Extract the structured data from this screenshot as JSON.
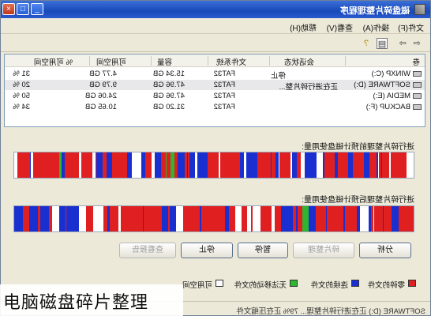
{
  "window": {
    "title": "磁盘碎片整理程序",
    "controls": [
      "_",
      "□",
      "×"
    ]
  },
  "menu": [
    "文件(F)",
    "操作(A)",
    "查看(V)",
    "帮助(H)"
  ],
  "toolbar": {
    "icons": [
      "back-icon",
      "forward-icon",
      "properties-icon",
      "help-icon"
    ]
  },
  "volumes": {
    "headers": [
      "卷",
      "会话状态",
      "文件系统",
      "容量",
      "可用空间",
      "% 可用空间"
    ],
    "rows": [
      {
        "volume": "WINXP (C:)",
        "status": "停止",
        "fs": "FAT32",
        "capacity": "15.34 GB",
        "free": "4.77 GB",
        "pct": "31 %"
      },
      {
        "volume": "SOFTWARE (D:)",
        "status": "正在进行碎片整...",
        "fs": "FAT32",
        "capacity": "47.96 GB",
        "free": "9.79 GB",
        "pct": "20 %"
      },
      {
        "volume": "MEDIA (E:)",
        "status": "",
        "fs": "FAT32",
        "capacity": "47.96 GB",
        "free": "24.06 GB",
        "pct": "50 %"
      },
      {
        "volume": "BACKUP (F:)",
        "status": "",
        "fs": "FAT32",
        "capacity": "31.20 GB",
        "free": "10.65 GB",
        "pct": "34 %"
      }
    ]
  },
  "before_label": "进行碎片整理前预计磁盘使用量:",
  "after_label": "进行碎片整理后预计磁盘使用量:",
  "colors": {
    "fragmented": "#e02020",
    "contiguous": "#1a2fd0",
    "unmovable": "#2fb52f",
    "free": "#ffffff"
  },
  "buttons": {
    "analyze": "分析",
    "defragment": "碎片整理",
    "pause": "暂停",
    "stop": "停止",
    "view_report": "查看报告"
  },
  "legend": {
    "fragmented": "零碎的文件",
    "contiguous": "连续的文件",
    "unmovable": "无法移动的文件",
    "free": "可用空间"
  },
  "status": "SOFTWARE (D:) 正在进行碎片整理... 79%  正在压缩文件",
  "caption": "电脑磁盘碎片整理"
}
